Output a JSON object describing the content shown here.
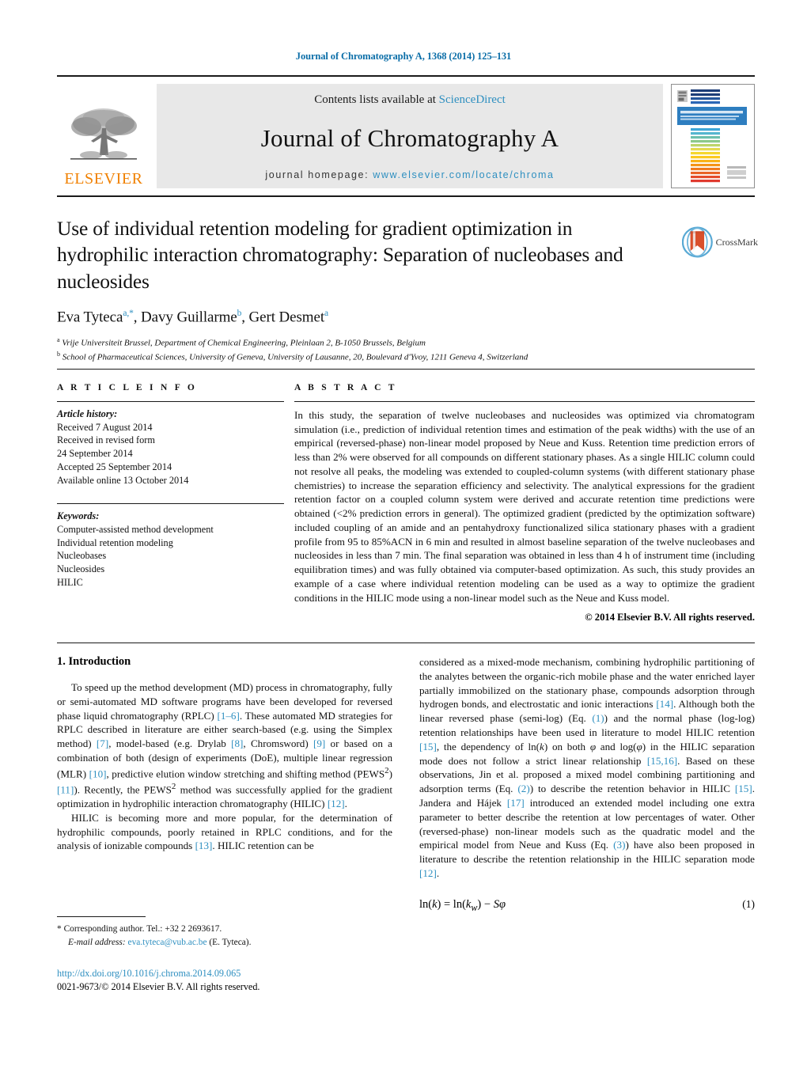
{
  "running_head": "Journal of Chromatography A, 1368 (2014) 125–131",
  "masthead": {
    "publisher_name": "ELSEVIER",
    "contents_prefix": "Contents lists available at ",
    "contents_link": "ScienceDirect",
    "journal_title": "Journal of Chromatography A",
    "homepage_prefix": "journal homepage: ",
    "homepage_url": "www.elsevier.com/locate/chroma",
    "cover_title": "JOURNAL OF CHROMATOGRAPHY A",
    "cover_subtitle": "INCLUDING ELECTROPHORESIS AND OTHER SEPARATION METHODS"
  },
  "crossmark": {
    "label": "CrossMark"
  },
  "article": {
    "title": "Use of individual retention modeling for gradient optimization in hydrophilic interaction chromatography: Separation of nucleobases and nucleosides",
    "authors_html": "Eva Tyteca<sup>a,*</sup>, Davy Guillarme<sup>b</sup>, Gert Desmet<sup>a</sup>",
    "affiliations": [
      "Vrije Universiteit Brussel, Department of Chemical Engineering, Pleinlaan 2, B-1050 Brussels, Belgium",
      "School of Pharmaceutical Sciences, University of Geneva, University of Lausanne, 20, Boulevard d'Yvoy, 1211 Geneva 4, Switzerland"
    ],
    "affiliation_marks": [
      "a",
      "b"
    ]
  },
  "article_info": {
    "heading": "A R T I C L E   I N F O",
    "history_label": "Article history:",
    "history": [
      "Received 7 August 2014",
      "Received in revised form",
      "24 September 2014",
      "Accepted 25 September 2014",
      "Available online 13 October 2014"
    ],
    "keywords_label": "Keywords:",
    "keywords": [
      "Computer-assisted method development",
      "Individual retention modeling",
      "Nucleobases",
      "Nucleosides",
      "HILIC"
    ]
  },
  "abstract": {
    "heading": "A B S T R A C T",
    "text": "In this study, the separation of twelve nucleobases and nucleosides was optimized via chromatogram simulation (i.e., prediction of individual retention times and estimation of the peak widths) with the use of an empirical (reversed-phase) non-linear model proposed by Neue and Kuss. Retention time prediction errors of less than 2% were observed for all compounds on different stationary phases. As a single HILIC column could not resolve all peaks, the modeling was extended to coupled-column systems (with different stationary phase chemistries) to increase the separation efficiency and selectivity. The analytical expressions for the gradient retention factor on a coupled column system were derived and accurate retention time predictions were obtained (<2% prediction errors in general). The optimized gradient (predicted by the optimization software) included coupling of an amide and an pentahydroxy functionalized silica stationary phases with a gradient profile from 95 to 85%ACN in 6 min and resulted in almost baseline separation of the twelve nucleobases and nucleosides in less than 7 min. The final separation was obtained in less than 4 h of instrument time (including equilibration times) and was fully obtained via computer-based optimization. As such, this study provides an example of a case where individual retention modeling can be used as a way to optimize the gradient conditions in the HILIC mode using a non-linear model such as the Neue and Kuss model.",
    "copyright": "© 2014 Elsevier B.V. All rights reserved."
  },
  "introduction": {
    "heading": "1.  Introduction",
    "para1_html": "To speed up the method development (MD) process in chromatography, fully or semi-automated MD software programs have been developed for reversed phase liquid chromatography (RPLC) <span class=\"ref\">[1–6]</span>. These automated MD strategies for RPLC described in literature are either search-based (e.g. using the Simplex method) <span class=\"ref\">[7]</span>, model-based (e.g. Drylab <span class=\"ref\">[8]</span>, Chromsword) <span class=\"ref\">[9]</span> or based on a combination of both (design of experiments (DoE), multiple linear regression (MLR) <span class=\"ref\">[10]</span>, predictive elution window stretching and shifting method (PEWS<sup>2</sup>) <span class=\"ref\">[11]</span>). Recently, the PEWS<sup>2</sup> method was successfully applied for the gradient optimization in hydrophilic interaction chromatography (HILIC) <span class=\"ref\">[12]</span>.",
    "para2_html": "HILIC is becoming more and more popular, for the determination of hydrophilic compounds, poorly retained in RPLC conditions, and for the analysis of ionizable compounds <span class=\"ref\">[13]</span>. HILIC retention can be",
    "para2_cont_html": "considered as a mixed-mode mechanism, combining hydrophilic partitioning of the analytes between the organic-rich mobile phase and the water enriched layer partially immobilized on the stationary phase, compounds adsorption through hydrogen bonds, and electrostatic and ionic interactions <span class=\"ref\">[14]</span>. Although both the linear reversed phase (semi-log) (Eq. <span class=\"ref\">(1)</span>) and the normal phase (log-log) retention relationships have been used in literature to model HILIC retention <span class=\"ref\">[15]</span>, the dependency of ln(<span class=\"it\">k</span>) on both <span class=\"it\">&#966;</span> and log(<span class=\"it\">&#966;</span>) in the HILIC separation mode does not follow a strict linear relationship <span class=\"ref\">[15,16]</span>. Based on these observations, Jin et al. proposed a mixed model combining partitioning and adsorption terms (Eq. <span class=\"ref\">(2)</span>) to describe the retention behavior in HILIC <span class=\"ref\">[15]</span>. Jandera and Hájek <span class=\"ref\">[17]</span> introduced an extended model including one extra parameter to better describe the retention at low percentages of water. Other (reversed-phase) non-linear models such as the quadratic model and the empirical model from Neue and Kuss (Eq. <span class=\"ref\">(3)</span>) have also been proposed in literature to describe the retention relationship in the HILIC separation mode <span class=\"ref\">[12]</span>."
  },
  "equation_1": {
    "body_html": "ln(<span class=\"it\">k</span>) = ln(<span class=\"it\">k<sub>w</sub></span>) &minus; <span class=\"it\">S&#966;</span>",
    "number": "(1)"
  },
  "footnote": {
    "star": "*",
    "corresponding_html": "Corresponding author. Tel.: +32 2 2693617.",
    "email_label": "E-mail address:",
    "email": "eva.tyteca@vub.ac.be",
    "email_owner": "(E. Tyteca)."
  },
  "footer": {
    "doi": "http://dx.doi.org/10.1016/j.chroma.2014.09.065",
    "issn_line": "0021-9673/© 2014 Elsevier B.V. All rights reserved."
  },
  "colors": {
    "link_blue": "#2e8fc0",
    "head_blue": "#0b6ea8",
    "elsevier_orange": "#f08000",
    "masthead_grey": "#e8e8e8"
  }
}
